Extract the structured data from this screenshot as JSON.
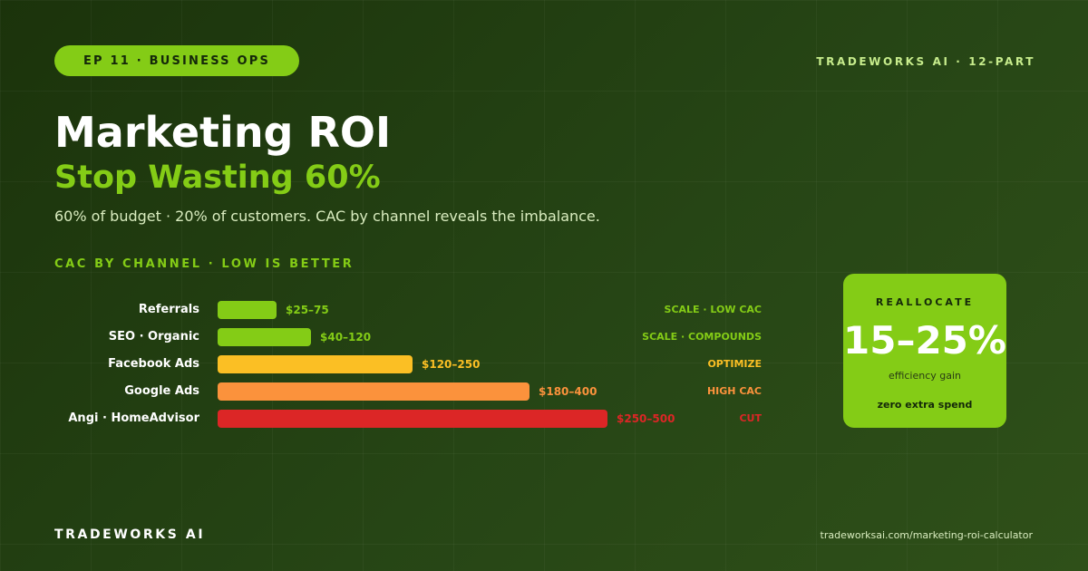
{
  "header": {
    "episode_pill": "EP 11 · BUSINESS OPS",
    "series_label": "TRADEWORKS AI · 12-PART"
  },
  "hero": {
    "title": "Marketing ROI",
    "subtitle": "Stop Wasting 60%",
    "description": "60% of budget · 20% of customers. CAC by channel reveals the imbalance."
  },
  "chart_data": {
    "type": "bar",
    "orientation": "horizontal",
    "title": "CAC BY CHANNEL · LOW IS BETTER",
    "unit": "$",
    "categories": [
      "Referrals",
      "SEO · Organic",
      "Facebook Ads",
      "Google Ads",
      "Angi · HomeAdvisor"
    ],
    "ranges": [
      [
        25,
        75
      ],
      [
        40,
        120
      ],
      [
        120,
        250
      ],
      [
        180,
        400
      ],
      [
        250,
        500
      ]
    ],
    "range_labels": [
      "$25–75",
      "$40–120",
      "$120–250",
      "$180–400",
      "$250–500"
    ],
    "actions": [
      "SCALE · LOW CAC",
      "SCALE · COMPOUNDS",
      "OPTIMIZE",
      "HIGH CAC",
      "CUT"
    ],
    "colors": [
      "#84cc16",
      "#84cc16",
      "#fbbf24",
      "#fb923c",
      "#dc2626"
    ],
    "xlim": [
      0,
      500
    ]
  },
  "card": {
    "heading": "REALLOCATE",
    "value": "15–25%",
    "caption": "efficiency gain",
    "note": "zero extra spend"
  },
  "footer": {
    "brand": "TRADEWORKS AI",
    "url": "tradeworksai.com/marketing-roi-calculator"
  }
}
